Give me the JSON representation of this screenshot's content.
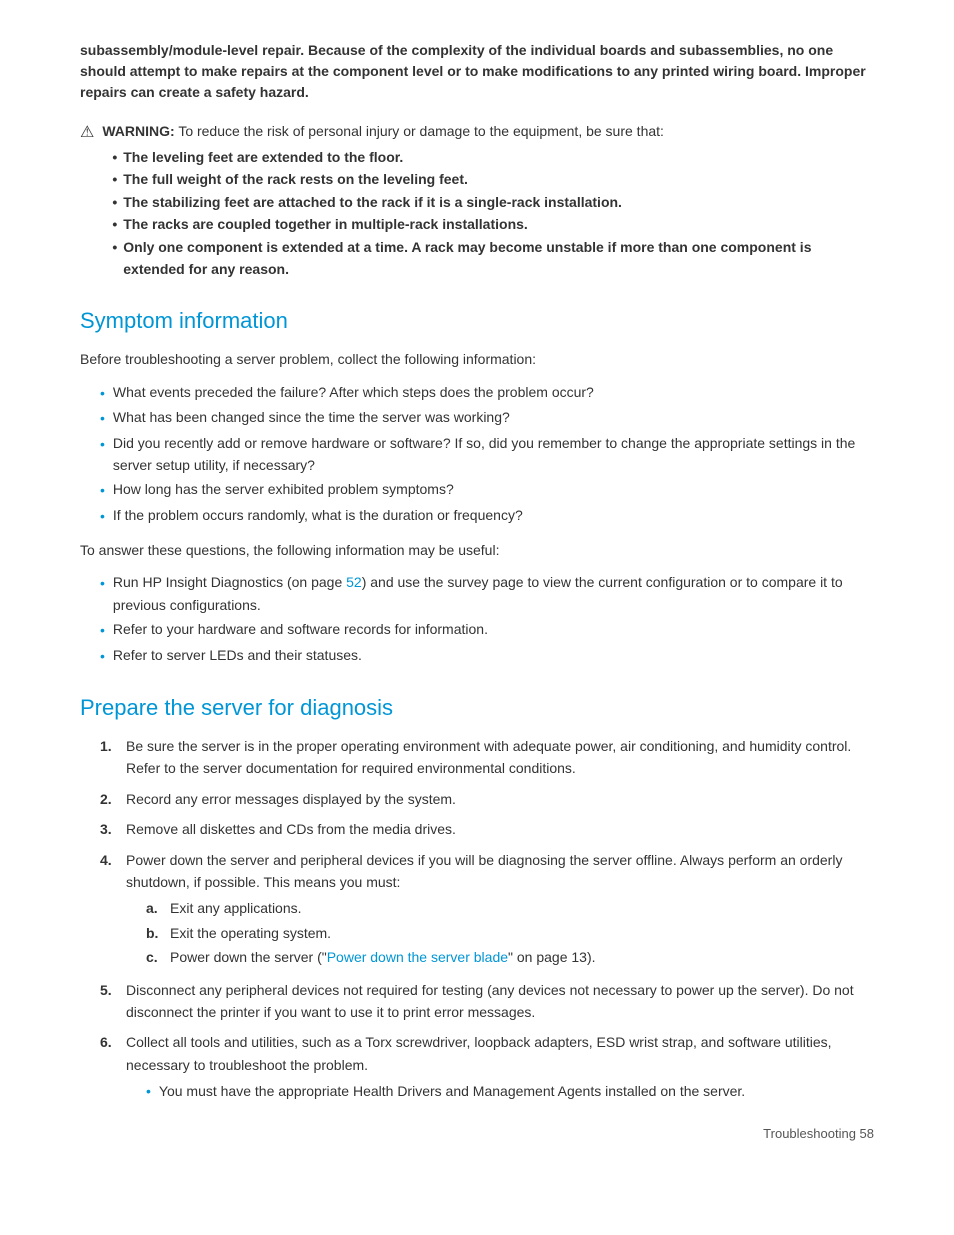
{
  "intro": {
    "bold_text": "subassembly/module-level repair. Because of the complexity of the individual boards and subassemblies, no one should attempt to make repairs at the component level or to make modifications to any printed wiring board. Improper repairs can create a safety hazard."
  },
  "warning": {
    "icon": "⚠",
    "label": "WARNING:",
    "text": " To reduce the risk of personal injury or damage to the equipment, be sure that:",
    "items": [
      "The leveling feet are extended to the floor.",
      "The full weight of the rack rests on the leveling feet.",
      "The stabilizing feet are attached to the rack if it is a single-rack installation.",
      "The racks are coupled together in multiple-rack installations.",
      "Only one component is extended at a time. A rack may become unstable if more than one component is extended for any reason."
    ]
  },
  "symptom_section": {
    "heading": "Symptom information",
    "intro": "Before troubleshooting a server problem, collect the following information:",
    "questions": [
      "What events preceded the failure? After which steps does the problem occur?",
      "What has been changed since the time the server was working?",
      "Did you recently add or remove hardware or software? If so, did you remember to change the appropriate settings in the server setup utility, if necessary?",
      "How long has the server exhibited problem symptoms?",
      "If the problem occurs randomly, what is the duration or frequency?"
    ],
    "answer_intro": "To answer these questions, the following information may be useful:",
    "answers": [
      {
        "text_before": "Run HP Insight Diagnostics (on page ",
        "link_text": "52",
        "text_after": ") and use the survey page to view the current configuration or to compare it to previous configurations."
      },
      {
        "text_plain": "Refer to your hardware and software records for information."
      },
      {
        "text_plain": "Refer to server LEDs and their statuses."
      }
    ]
  },
  "prepare_section": {
    "heading": "Prepare the server for diagnosis",
    "steps": [
      {
        "num": "1.",
        "text": "Be sure the server is in the proper operating environment with adequate power, air conditioning, and humidity control. Refer to the server documentation for required environmental conditions."
      },
      {
        "num": "2.",
        "text": "Record any error messages displayed by the system."
      },
      {
        "num": "3.",
        "text": "Remove all diskettes and CDs from the media drives."
      },
      {
        "num": "4.",
        "text": "Power down the server and peripheral devices if you will be diagnosing the server offline. Always perform an orderly shutdown, if possible. This means you must:",
        "substeps": [
          {
            "alpha": "a.",
            "text": "Exit any applications."
          },
          {
            "alpha": "b.",
            "text": "Exit the operating system."
          },
          {
            "alpha": "c.",
            "text_before": "Power down the server (\"",
            "link_text": "Power down the server blade",
            "text_after": "\" on page 13)."
          }
        ]
      },
      {
        "num": "5.",
        "text": "Disconnect any peripheral devices not required for testing (any devices not necessary to power up the server). Do not disconnect the printer if you want to use it to print error messages."
      },
      {
        "num": "6.",
        "text": "Collect all tools and utilities, such as a Torx screwdriver, loopback adapters, ESD wrist strap, and software utilities, necessary to troubleshoot the problem.",
        "bullets": [
          "You must have the appropriate Health Drivers and Management Agents installed on the server."
        ]
      }
    ]
  },
  "footer": {
    "text": "Troubleshooting    58"
  }
}
